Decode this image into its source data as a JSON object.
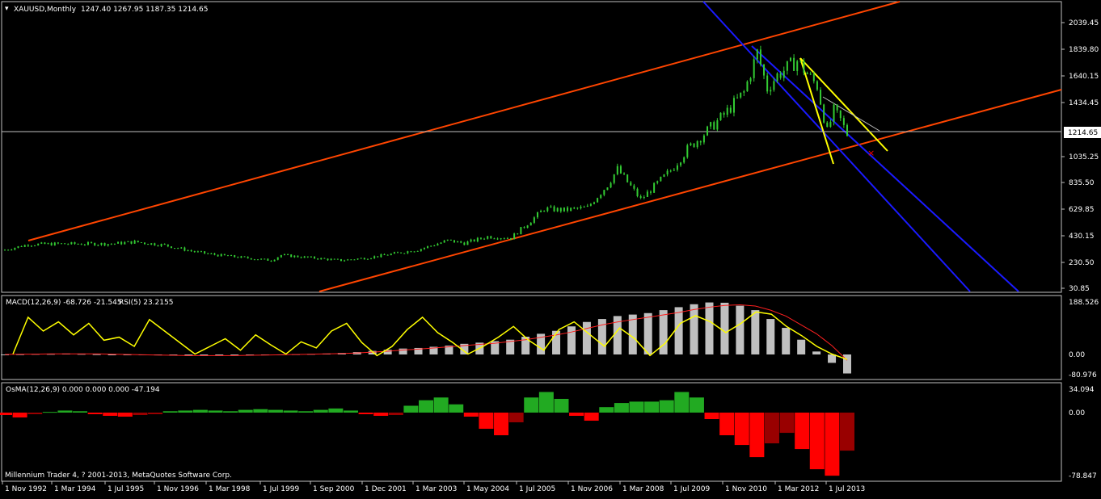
{
  "main_panel": {
    "title_symbol": "XAUUSD,Monthly",
    "ohlc_text": "1247.40 1267.95 1187.35 1214.65",
    "current_price_label": "1214.65",
    "current_price": 1214.65,
    "price_axis_labels": [
      "2039.45",
      "1839.80",
      "1640.15",
      "1434.45",
      "1214.65",
      "1035.25",
      "835.50",
      "629.85",
      "430.15",
      "230.50",
      "30.85"
    ]
  },
  "macd_panel": {
    "title": "MACD(12,26,9) -68.726 -21.545",
    "rsi_title": "RSI(5) 23.2155",
    "axis_labels": [
      "188.526",
      "0.00",
      "-80.976"
    ]
  },
  "osma_panel": {
    "title": "OsMA(12,26,9) 0.000 0.000 0.000 -47.194",
    "axis_labels": [
      "34.094",
      "0.00",
      "-78.847"
    ],
    "copyright": "Millennium Trader 4, ? 2001-2013, MetaQuotes Software Corp."
  },
  "time_axis_labels": [
    "1 Nov 1992",
    "1 Mar 1994",
    "1 Jul 1995",
    "1 Nov 1996",
    "1 Mar 1998",
    "1 Jul 1999",
    "1 Sep 2000",
    "1 Dec 2001",
    "1 Mar 2003",
    "1 May 2004",
    "1 Jul 2005",
    "1 Nov 2006",
    "1 Mar 2008",
    "1 Jul 2009",
    "1 Nov 2010",
    "1 Mar 2012",
    "1 Jul 2013"
  ],
  "colors": {
    "background": "#000000",
    "candle": "#33cc33",
    "orange_channel": "#ff4500",
    "blue_channel": "#1a1aff",
    "yellow_lines": "#ffff00",
    "macd_hist": "#c0c0c0",
    "macd_signal": "#ff2020",
    "rsi": "#ffff00",
    "osma_pos": "#22aa22",
    "osma_neg_light": "#ff0000",
    "osma_neg_dark": "#990000",
    "grid_border": "#c0c0c0",
    "marker": "#ff0000"
  },
  "chart_data": [
    {
      "type": "line",
      "title": "XAUUSD,Monthly",
      "ylim": [
        30.85,
        2140
      ],
      "points": [
        {
          "x": "1992-11",
          "y": 340
        },
        {
          "x": "1993-06",
          "y": 380
        },
        {
          "x": "1994-03",
          "y": 385
        },
        {
          "x": "1995-07",
          "y": 385
        },
        {
          "x": "1996-02",
          "y": 400
        },
        {
          "x": "1996-11",
          "y": 375
        },
        {
          "x": "1997-08",
          "y": 325
        },
        {
          "x": "1998-03",
          "y": 300
        },
        {
          "x": "1999-07",
          "y": 260
        },
        {
          "x": "1999-10",
          "y": 300
        },
        {
          "x": "2000-09",
          "y": 275
        },
        {
          "x": "2001-04",
          "y": 260
        },
        {
          "x": "2001-12",
          "y": 280
        },
        {
          "x": "2002-10",
          "y": 320
        },
        {
          "x": "2003-03",
          "y": 340
        },
        {
          "x": "2003-12",
          "y": 410
        },
        {
          "x": "2004-05",
          "y": 390
        },
        {
          "x": "2004-12",
          "y": 440
        },
        {
          "x": "2005-07",
          "y": 430
        },
        {
          "x": "2006-01",
          "y": 560
        },
        {
          "x": "2006-05",
          "y": 650
        },
        {
          "x": "2006-11",
          "y": 640
        },
        {
          "x": "2007-06",
          "y": 660
        },
        {
          "x": "2007-12",
          "y": 830
        },
        {
          "x": "2008-03",
          "y": 950
        },
        {
          "x": "2008-10",
          "y": 720
        },
        {
          "x": "2009-07",
          "y": 940
        },
        {
          "x": "2009-12",
          "y": 1100
        },
        {
          "x": "2010-06",
          "y": 1240
        },
        {
          "x": "2010-11",
          "y": 1360
        },
        {
          "x": "2011-05",
          "y": 1530
        },
        {
          "x": "2011-09",
          "y": 1830
        },
        {
          "x": "2011-12",
          "y": 1560
        },
        {
          "x": "2012-03",
          "y": 1660
        },
        {
          "x": "2012-09",
          "y": 1770
        },
        {
          "x": "2012-12",
          "y": 1670
        },
        {
          "x": "2013-03",
          "y": 1580
        },
        {
          "x": "2013-06",
          "y": 1230
        },
        {
          "x": "2013-08",
          "y": 1390
        },
        {
          "x": "2013-10",
          "y": 1320
        },
        {
          "x": "2013-12",
          "y": 1214.65
        }
      ]
    },
    {
      "type": "bar",
      "title": "MACD(12,26,9) -68.726 -21.545",
      "ylim": [
        -80.976,
        188.526
      ],
      "series": [
        {
          "name": "MACD",
          "values": [
            0,
            1,
            2,
            2,
            3,
            2,
            1,
            0,
            -1,
            -2,
            -3,
            -4,
            -5,
            -5,
            -4,
            -3,
            -2,
            -1,
            0,
            1,
            2,
            3,
            5,
            8,
            12,
            16,
            20,
            22,
            26,
            30,
            36,
            40,
            45,
            50,
            60,
            70,
            80,
            95,
            110,
            120,
            130,
            135,
            140,
            150,
            160,
            170,
            176,
            175,
            165,
            150,
            120,
            90,
            50,
            10,
            -30,
            -68
          ]
        },
        {
          "name": "Signal",
          "values": [
            0,
            1,
            1,
            2,
            2,
            2,
            2,
            1,
            0,
            -1,
            -2,
            -3,
            -4,
            -4,
            -4,
            -4,
            -3,
            -2,
            -1,
            0,
            1,
            2,
            3,
            5,
            8,
            11,
            15,
            18,
            22,
            26,
            30,
            34,
            38,
            44,
            50,
            58,
            66,
            76,
            88,
            100,
            110,
            118,
            126,
            134,
            142,
            152,
            160,
            166,
            168,
            164,
            150,
            130,
            100,
            70,
            30,
            -21
          ]
        }
      ]
    },
    {
      "type": "bar",
      "title": "OsMA(12,26,9) 0.000 0.000 0.000 -47.194",
      "ylim": [
        -78.847,
        34.094
      ],
      "values": [
        -3,
        -6,
        -2,
        1,
        3,
        2,
        -2,
        -4,
        -5,
        -3,
        -2,
        2,
        3,
        4,
        3,
        2,
        4,
        5,
        4,
        3,
        2,
        4,
        6,
        3,
        -2,
        -4,
        -3,
        10,
        18,
        22,
        12,
        -5,
        -20,
        -28,
        -12,
        22,
        30,
        20,
        -4,
        -10,
        8,
        14,
        16,
        16,
        18,
        30,
        22,
        -8,
        -28,
        -40,
        -55,
        -38,
        -25,
        -45,
        -70,
        -78,
        -47
      ]
    },
    {
      "type": "line",
      "title": "RSI(5) 23.2155",
      "values": [
        30,
        78,
        60,
        72,
        55,
        70,
        48,
        52,
        40,
        75,
        60,
        45,
        30,
        40,
        50,
        35,
        55,
        42,
        30,
        46,
        38,
        60,
        70,
        45,
        28,
        40,
        62,
        78,
        58,
        45,
        30,
        40,
        52,
        66,
        48,
        35,
        62,
        72,
        56,
        40,
        64,
        50,
        28,
        44,
        70,
        80,
        72,
        58,
        70,
        85,
        82,
        66,
        54,
        40,
        30,
        23
      ]
    }
  ]
}
